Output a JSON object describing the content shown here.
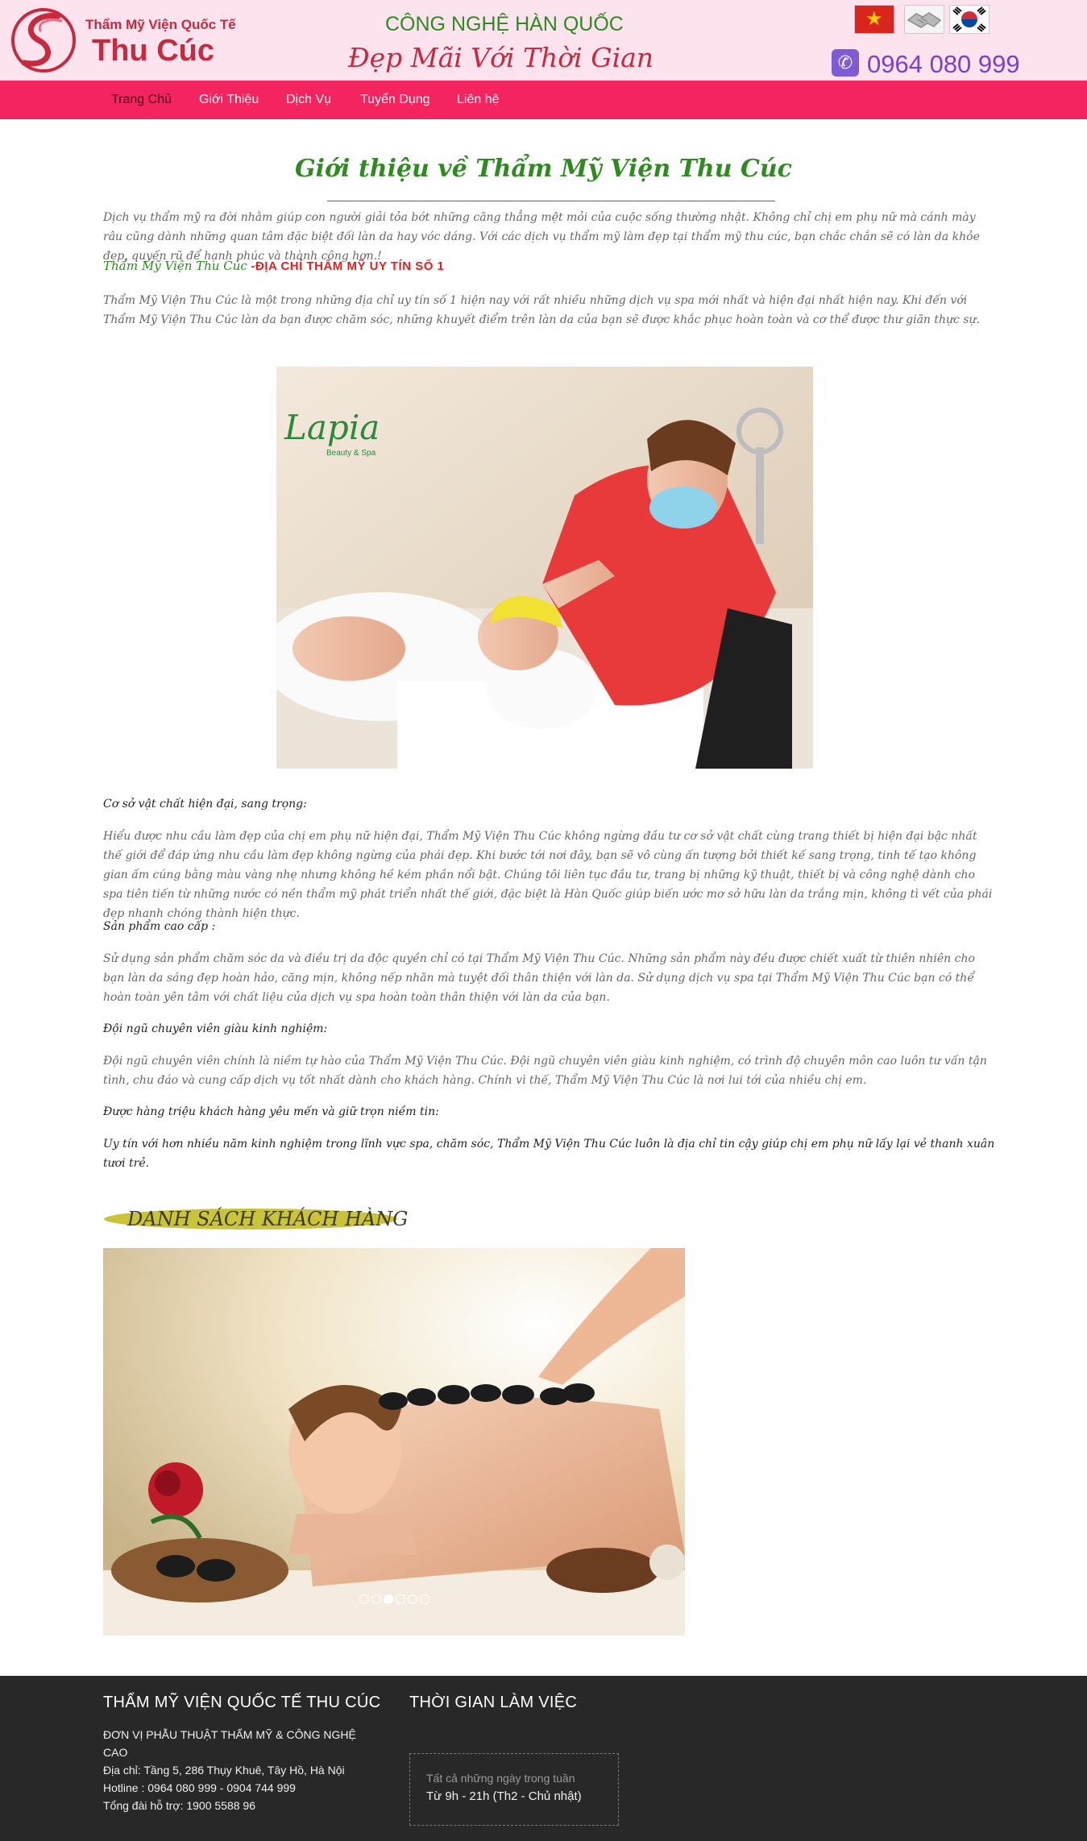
{
  "header": {
    "logo_top": "Thẩm Mỹ Viện Quốc Tế",
    "logo_main": "Thu Cúc",
    "slogan_line1": "CÔNG NGHỆ HÀN QUỐC",
    "slogan_line2": "Đẹp Mãi Với Thời Gian",
    "hotline": "0964 080 999",
    "languages": [
      "vietnam-flag-icon",
      "handshake-icon",
      "korea-flag-icon"
    ]
  },
  "nav": {
    "items": [
      "Trang Chủ",
      "Giới Thiệu",
      "Dịch Vụ",
      "Tuyển Dụng",
      "Liên hệ"
    ],
    "active": "Trang Chủ"
  },
  "main": {
    "title": "Giới thiệu về Thẩm Mỹ Viện Thu Cúc",
    "intro_1": "Dịch vụ thẩm mỹ ra đời nhằm giúp con người giải tỏa bớt những căng thẳng mệt mỏi của cuộc sống thường nhật. Không chỉ chị em phụ nữ mà cánh mày râu cũng dành những quan tâm đặc biệt đối làn da hay vóc dáng. Với các dịch vụ thẩm mỹ làm đẹp tại thẩm mỹ thu cúc, bạn chắc chắn sẽ có làn da khỏe đẹp, quyến rũ để hạnh phúc và thành công hơn.!",
    "highlight_green": "Thẩm Mỹ Viện Thu Cúc ",
    "highlight_red": "-ĐỊA CHỈ THẨM MỸ UY TÍN SỐ 1",
    "intro_2": "Thẩm Mỹ Viện Thu Cúc là một trong những địa chỉ uy tín số 1 hiện nay với rất nhiều những dịch vụ spa mới nhất và hiện đại nhất hiện nay. Khi đến với Thẩm Mỹ Viện Thu Cúc làn da bạn được chăm sóc, những khuyết điểm trên làn da của bạn sẽ được khắc phục hoàn toàn và cơ thể được thư giãn thực sự.",
    "image_logo_text": "Lapia",
    "image_logo_sub": "Beauty & Spa",
    "sections": [
      {
        "heading": "Cơ sở vật chất hiện đại, sang trọng:",
        "body": "Hiểu được nhu cầu làm đẹp của chị em phụ nữ hiện đại, Thẩm Mỹ Viện Thu Cúc không ngừng đầu tư cơ sở vật chất cùng trang thiết bị hiện đại bậc nhất thế giới để đáp ứng nhu cầu làm đẹp không ngừng của phái đẹp. Khi bước tới nơi đây, bạn sẽ vô cùng ấn tượng bởi thiết kế sang trọng, tinh tế tạo không gian ấm cúng bằng màu vàng nhẹ nhưng không hề kém phần nổi bật. Chúng tôi liên tục đầu tư, trang bị những kỹ thuật, thiết bị và công nghệ dành cho spa tiên tiến từ những nước có nền thẩm mỹ phát triển nhất thế giới, đặc biệt là Hàn Quốc giúp biến ước mơ sở hữu làn da trắng mịn, không tì vết của phái đẹp nhanh chóng thành hiện thực."
      },
      {
        "heading": "Sản phẩm cao cấp :",
        "body": "Sử dụng sản phẩm chăm sóc da và điều trị da độc quyền chỉ có tại Thẩm Mỹ Viện Thu Cúc. Những sản phẩm này đều được chiết xuất từ thiên nhiên cho bạn làn da sáng đẹp hoàn hảo, căng mịn, không nếp nhăn mà tuyệt đối thân thiện với làn da. Sử dụng dịch vụ spa tại Thẩm Mỹ Viện Thu Cúc bạn có thể hoàn toàn yên tâm với chất liệu của dịch vụ spa hoàn toàn thân thiện với làn da của bạn."
      },
      {
        "heading": "Đội ngũ chuyên viên giàu kinh nghiệm:",
        "body": "Đội ngũ chuyên viên chính là niềm tự hào của Thẩm Mỹ Viện Thu Cúc. Đội ngũ chuyên viên giàu kinh nghiệm, có trình độ chuyên môn cao luôn tư vấn tận tình, chu đáo và cung cấp dịch vụ tốt nhất dành cho khách hàng. Chính vì thế, Thẩm Mỹ Viện Thu Cúc là nơi lui tới của nhiều chị em."
      },
      {
        "heading": "Được hàng triệu khách hàng yêu mến và giữ trọn niềm tin:",
        "body": "Uy tín với hơn nhiều năm kinh nghiệm trong lĩnh vực spa, chăm sóc, Thẩm Mỹ Viện Thu Cúc luôn là địa chỉ tin cậy giúp chị em phụ nữ lấy lại vẻ thanh xuân tươi trẻ."
      }
    ],
    "customers_title": "DANH SÁCH KHÁCH HÀNG",
    "slider": {
      "total_slides": 6,
      "active_index": 2
    }
  },
  "footer": {
    "col1_title": "THẨM MỸ VIỆN QUỐC TẾ THU CÚC",
    "col1_lines": [
      "ĐƠN VỊ PHẪU THUẬT THẨM MỸ & CÔNG NGHỆ",
      "CAO",
      "Địa chỉ: Tầng 5, 286 Thụy Khuê, Tây Hồ, Hà Nội",
      "Hotline : 0964 080 999 - 0904 744 999",
      "Tổng đài hỗ trợ: 1900 5588 96"
    ],
    "col2_title": "THỜI GIAN LÀM VIỆC",
    "hours_label": "Tất cả những ngày trong tuần",
    "hours_value": "Từ 9h - 21h (Th2 - Chủ nhật)"
  },
  "colors": {
    "header_bg": "#fce3ee",
    "nav_bg": "#f3245e",
    "brand_red": "#c8293f",
    "brand_green": "#2e8b1f",
    "hotline_purple": "#7b3fd0",
    "footer_bg": "#282828"
  }
}
